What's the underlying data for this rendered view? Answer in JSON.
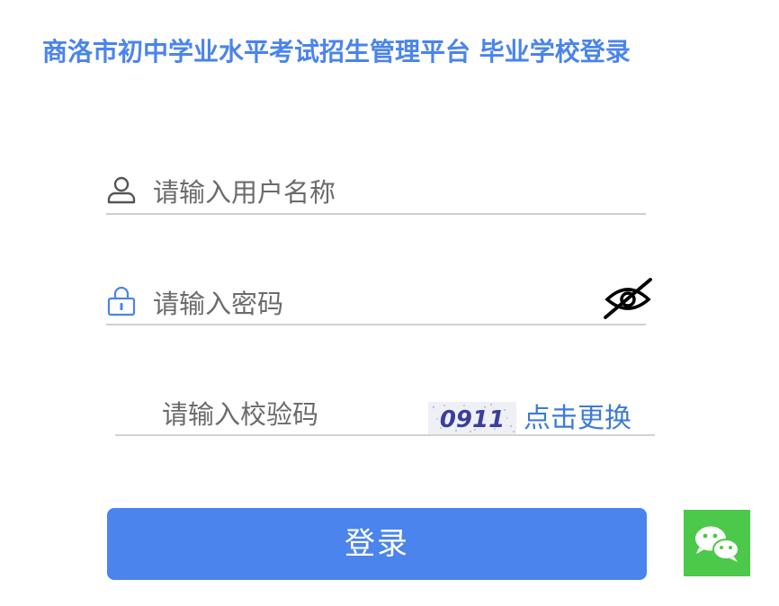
{
  "header": {
    "title": "商洛市初中学业水平考试招生管理平台  毕业学校登录"
  },
  "form": {
    "username": {
      "placeholder": "请输入用户名称",
      "value": "",
      "icon": "user-icon"
    },
    "password": {
      "placeholder": "请输入密码",
      "value": "",
      "icon": "lock-icon",
      "visibility_toggle_icon": "eye-off-icon"
    },
    "captcha": {
      "placeholder": "请输入校验码",
      "value": "",
      "image_text": "0911",
      "refresh_label": "点击更换"
    },
    "login_label": "登录"
  },
  "floating": {
    "wechat_icon": "wechat-icon"
  },
  "colors": {
    "primary": "#4a84ec",
    "link": "#3d7bd8",
    "divider": "#cfcfcf",
    "wechat": "#4cc84a"
  }
}
